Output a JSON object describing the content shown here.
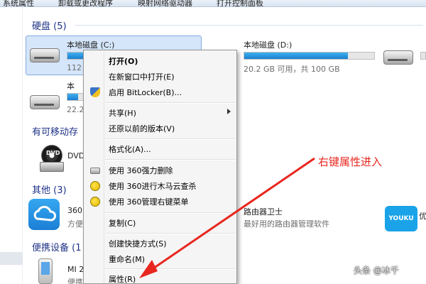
{
  "toolbar": {
    "items": [
      "系统属性",
      "卸载或更改程序",
      "映射网络驱动器",
      "打开控制面板"
    ]
  },
  "groups": {
    "hard_disks": "硬盘 (5)",
    "removable": "有可移动存",
    "other": "其他 (3)",
    "portable": "便携设备 (1"
  },
  "drives": {
    "c": {
      "name": "本地磁盘 (C:)",
      "info": "112",
      "fill": 0.72
    },
    "d": {
      "name": "本地磁盘 (D:)",
      "info": "20.2 GB 可用，共 100 GB",
      "fill": 0.8
    },
    "second": {
      "name": "本",
      "info": "22.2",
      "fill": 0.55
    },
    "dvd": {
      "name": "DVD"
    },
    "cloud": {
      "name": "360",
      "info": "方便"
    },
    "router": {
      "name": "路由器卫士",
      "info": "最好用的路由器管理软件"
    },
    "youku": {
      "name": "优",
      "logo": "YOUKU"
    },
    "phone": {
      "name": "MI 2",
      "info": "便携"
    }
  },
  "menu": {
    "items": [
      {
        "label": "打开(O)",
        "bold": true
      },
      {
        "label": "在新窗口中打开(E)"
      },
      {
        "label": "启用 BitLocker(B)...",
        "icon": "shield-icon"
      },
      {
        "label": "共享(H)",
        "submenu": true
      },
      {
        "label": "还原以前的版本(V)"
      },
      {
        "label": "格式化(A)..."
      },
      {
        "label": "使用 360强力删除",
        "icon": "drive-icon"
      },
      {
        "label": "使用 360进行木马云查杀",
        "icon": "360-icon"
      },
      {
        "label": "使用 360管理右键菜单",
        "icon": "360-icon"
      },
      {
        "label": "复制(C)"
      },
      {
        "label": "创建快捷方式(S)"
      },
      {
        "label": "重命名(M)"
      },
      {
        "label": "属性(R)"
      }
    ]
  },
  "annotation": {
    "text": "右键属性进入",
    "color": "#e8271f"
  },
  "watermark": "头条 @冰千",
  "colors": {
    "accent": "#1e3287",
    "selection": "#d5e6fb",
    "bar": "#1a7fd0"
  }
}
